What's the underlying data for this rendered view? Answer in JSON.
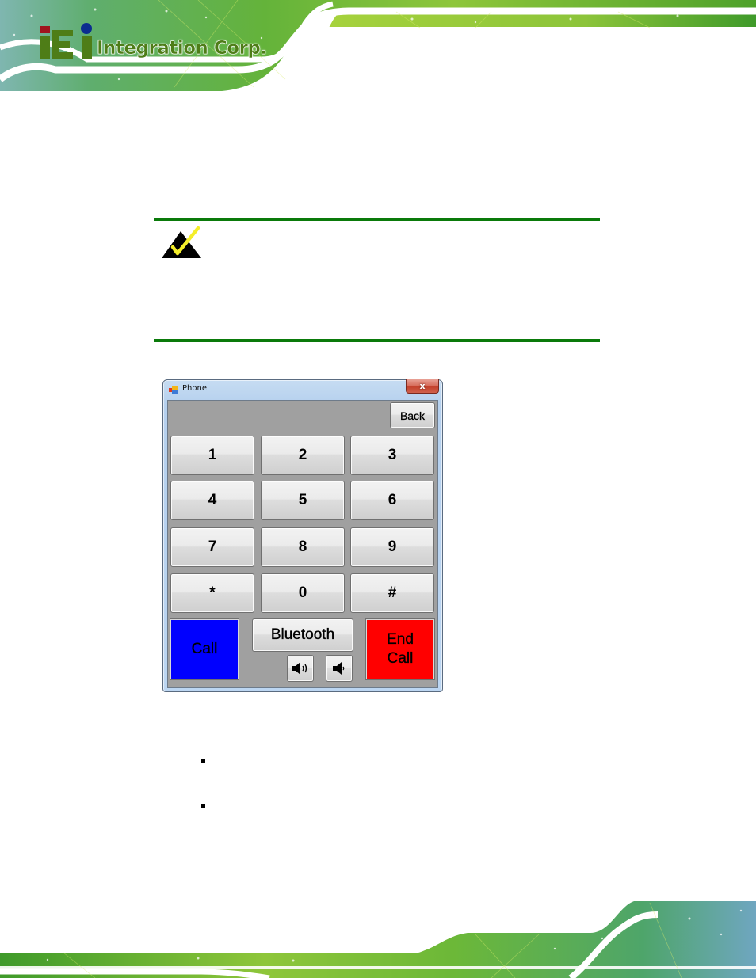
{
  "header": {
    "brand_mark": "iEi",
    "brand_name": "Integration Corp.",
    "brand_colors": {
      "green": "#4e7d17",
      "red": "#a0141e",
      "blue": "#0b2c8f"
    }
  },
  "note": {
    "icon": "note-check-icon",
    "rule_color": "#0a7a0a"
  },
  "phone_window": {
    "title": "Phone",
    "close_label": "x",
    "back_label": "Back",
    "keypad": [
      [
        "1",
        "2",
        "3"
      ],
      [
        "4",
        "5",
        "6"
      ],
      [
        "7",
        "8",
        "9"
      ],
      [
        "*",
        "0",
        "#"
      ]
    ],
    "call_label": "Call",
    "call_color": "#0000ff",
    "bluetooth_label": "Bluetooth",
    "end_call_label": "End\nCall",
    "end_call_color": "#ff0000",
    "volume_up_icon": "speaker-loud-icon",
    "volume_down_icon": "speaker-quiet-icon"
  },
  "bullets": [
    {
      "text": ""
    },
    {
      "text": ""
    }
  ]
}
